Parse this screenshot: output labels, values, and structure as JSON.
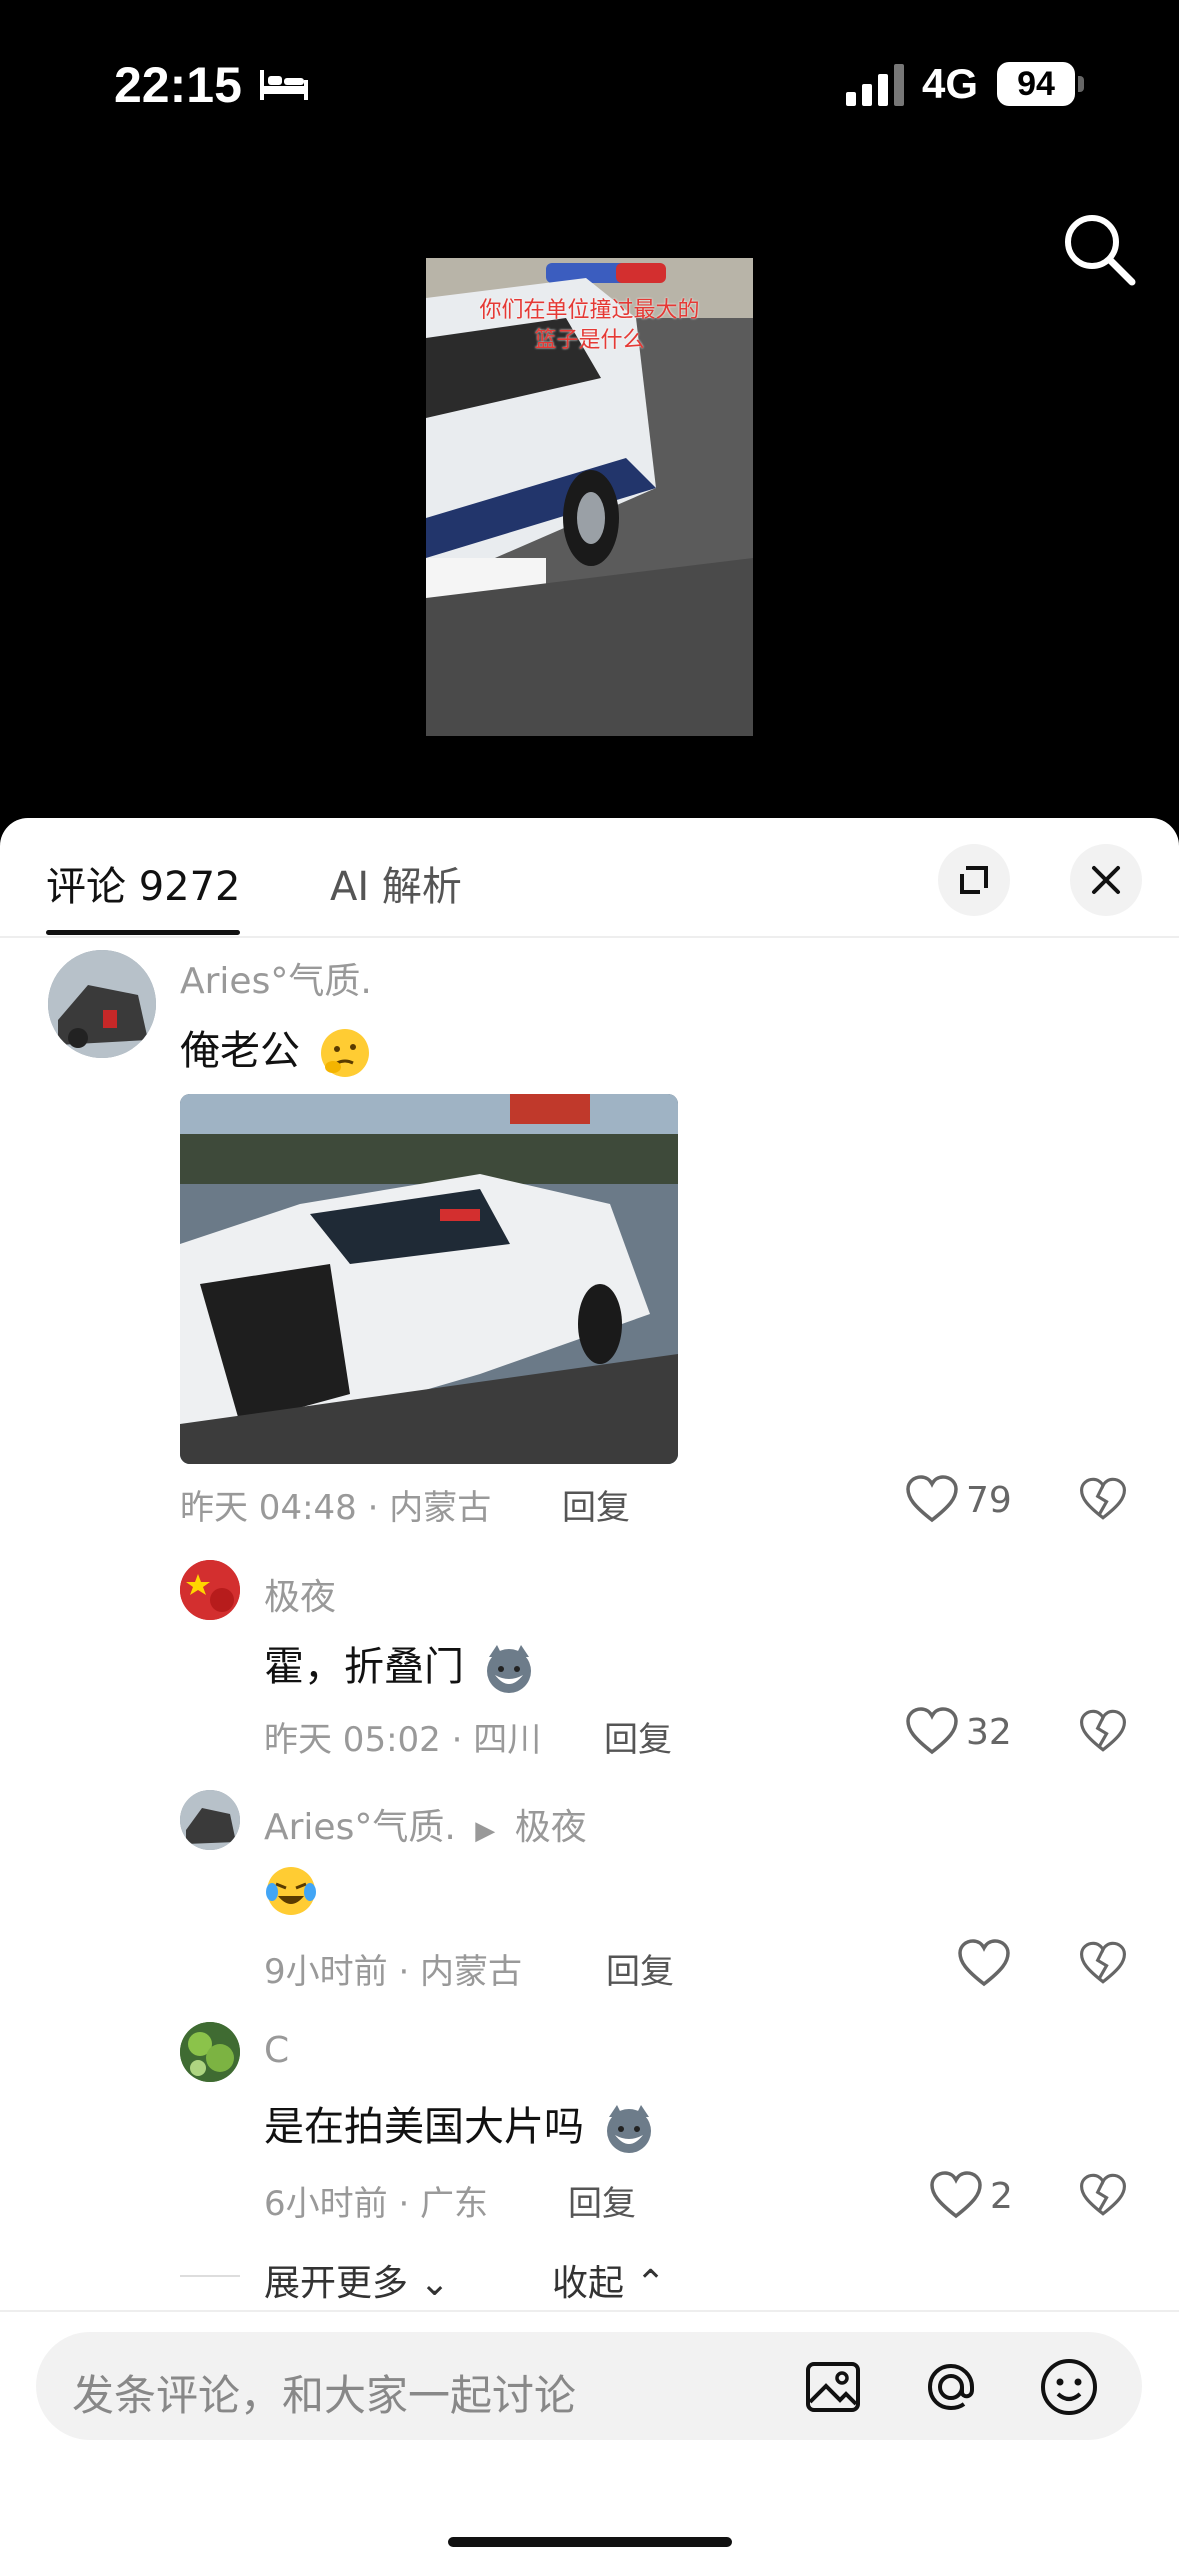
{
  "status_bar": {
    "time": "22:15",
    "network": "4G",
    "battery": "94"
  },
  "video": {
    "caption_line1": "你们在单位撞过最大的",
    "caption_line2": "篮子是什么"
  },
  "tabs": {
    "comments": "评论 9272",
    "ai": "AI 解析"
  },
  "comments": [
    {
      "user": "Aries°气质.",
      "text": "俺老公",
      "time_location": "昨天 04:48 · 内蒙古",
      "reply": "回复",
      "likes": "79",
      "has_image": true,
      "replies": [
        {
          "user": "极夜",
          "text": "霍，折叠门",
          "time_location": "昨天 05:02 · 四川",
          "reply": "回复",
          "likes": "32"
        },
        {
          "user": "Aries°气质.",
          "reply_to": "极夜",
          "text": "",
          "time_location": "9小时前 · 内蒙古",
          "reply": "回复",
          "likes": ""
        },
        {
          "user": "C",
          "text": "是在拍美国大片吗",
          "time_location": "6小时前 · 广东",
          "reply": "回复",
          "likes": "2"
        }
      ]
    }
  ],
  "thread_controls": {
    "expand_more": "展开更多",
    "collapse": "收起"
  },
  "input": {
    "placeholder": "发条评论，和大家一起讨论"
  }
}
